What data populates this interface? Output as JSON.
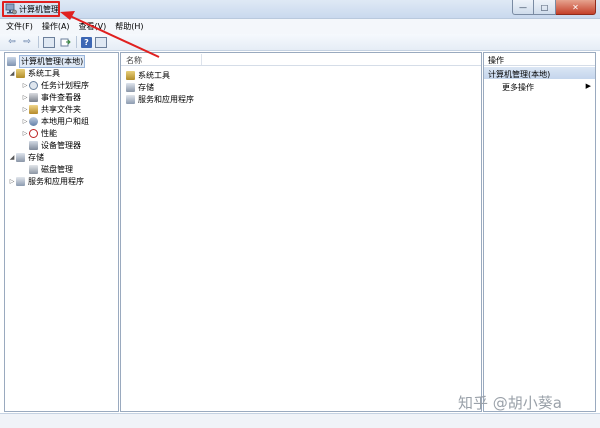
{
  "window": {
    "title": "计算机管理",
    "controls": {
      "minimize": "—",
      "maximize": "□",
      "close": "✕"
    }
  },
  "menu": {
    "items": [
      {
        "label": "文件(F)"
      },
      {
        "label": "操作(A)"
      },
      {
        "label": "查看(V)"
      },
      {
        "label": "帮助(H)"
      }
    ]
  },
  "toolbar": {
    "back": "⇦",
    "forward": "⇨",
    "help": "?"
  },
  "tree": {
    "root": "计算机管理(本地)",
    "system_tools": "系统工具",
    "task_scheduler": "任务计划程序",
    "event_viewer": "事件查看器",
    "shared_folders": "共享文件夹",
    "local_users": "本地用户和组",
    "performance": "性能",
    "device_manager": "设备管理器",
    "storage": "存储",
    "disk_management": "磁盘管理",
    "services_apps": "服务和应用程序"
  },
  "center": {
    "column_name": "名称",
    "rows": [
      {
        "label": "系统工具"
      },
      {
        "label": "存储"
      },
      {
        "label": "服务和应用程序"
      }
    ]
  },
  "actions": {
    "title": "操作",
    "section": "计算机管理(本地)",
    "more": "更多操作"
  },
  "watermark": "知乎 @胡小葵a",
  "colors": {
    "highlight": "#e0201f",
    "selection": "#dfe9f6",
    "section_header": "#c4d5ec"
  }
}
